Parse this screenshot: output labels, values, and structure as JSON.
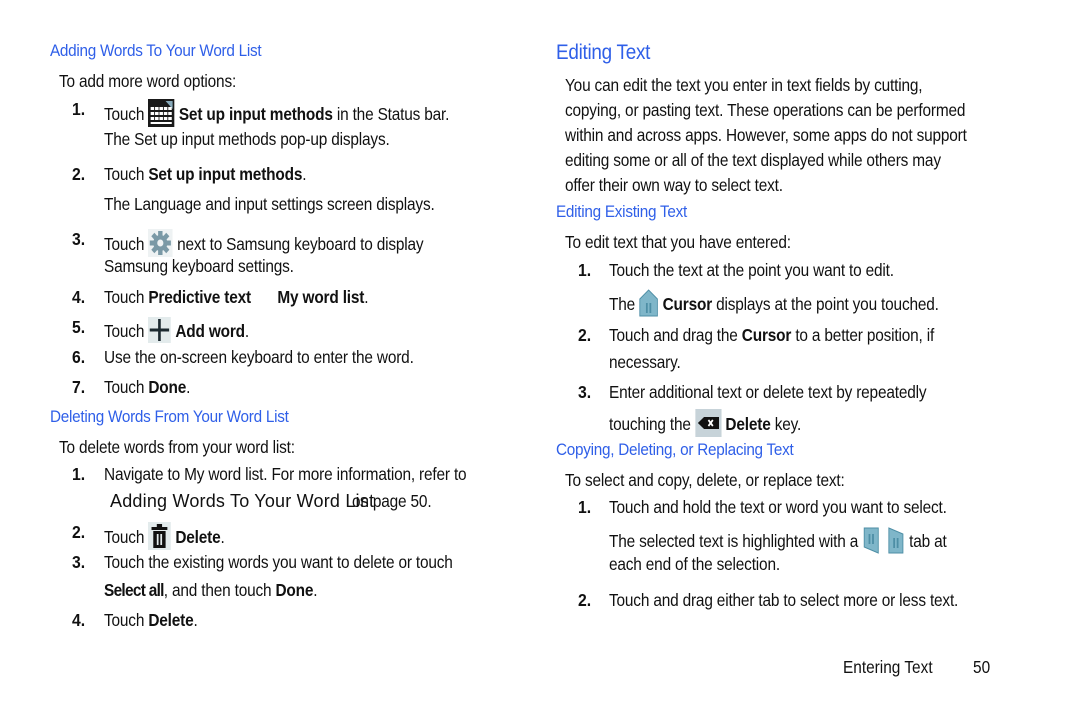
{
  "left": {
    "section1": {
      "heading": "Adding Words To Your Word List",
      "intro": "To add more word options:",
      "steps": [
        {
          "num": "1.",
          "pre": "Touch",
          "icon": "keyboard-icon",
          "bold": "Set up input methods",
          "post": " in the Status bar.",
          "sub": "The Set up input methods pop-up displays."
        },
        {
          "num": "2.",
          "pre": "Touch ",
          "bold": "Set up input methods",
          "post": ".",
          "sub": "The Language and input settings screen displays."
        },
        {
          "num": "3.",
          "pre": "Touch",
          "icon": "gear-icon",
          "post": " next to Samsung keyboard to display",
          "cont": "Samsung keyboard settings."
        },
        {
          "num": "4.",
          "pre": "Touch ",
          "bold": "Predictive text",
          "bold2": "My word list",
          "post": "."
        },
        {
          "num": "5.",
          "pre": "Touch",
          "icon": "plus-icon",
          "bold": "Add word",
          "post": "."
        },
        {
          "num": "6.",
          "pre": "Use the on-screen keyboard to enter the word."
        },
        {
          "num": "7.",
          "pre": "Touch ",
          "bold": "Done",
          "post": "."
        }
      ]
    },
    "section2": {
      "heading": "Deleting Words From Your Word List",
      "intro": "To delete words from your word list:",
      "steps": [
        {
          "num": "1.",
          "pre": "Navigate to My word list. For more information, refer to",
          "link": "Adding Words To Your Word List",
          "post": "on page 50."
        },
        {
          "num": "2.",
          "pre": "Touch",
          "icon": "trash-icon",
          "bold": "Delete",
          "post": "."
        },
        {
          "num": "3.",
          "pre": "Touch the existing words you want to delete or touch",
          "bold": "Select all",
          "mid": ", and then touch ",
          "bold2": "Done",
          "post": "."
        },
        {
          "num": "4.",
          "pre": "Touch ",
          "bold": "Delete",
          "post": "."
        }
      ]
    }
  },
  "right": {
    "title": "Editing Text",
    "paragraph": [
      "You can edit the text you enter in text fields by cutting,",
      "copying, or pasting text. These operations can be performed",
      "within and across apps. However, some apps do not support",
      "editing some or all of the text displayed while others may",
      "offer their own way to select text."
    ],
    "section1": {
      "heading": "Editing Existing Text",
      "intro": "To edit text that you have entered:",
      "steps": [
        {
          "num": "1.",
          "pre": "Touch the text at the point you want to edit.",
          "sub_pre": "The",
          "sub_icon": "cursor-icon",
          "sub_bold": "Cursor",
          "sub_post": " displays at the point you touched."
        },
        {
          "num": "2.",
          "pre": "Touch and drag the ",
          "bold": "Cursor",
          "post": " to a better position, if",
          "cont": "necessary."
        },
        {
          "num": "3.",
          "pre": "Enter additional text or delete text by repeatedly",
          "cont_pre": "touching the",
          "cont_icon": "backspace-icon",
          "cont_bold": "Delete",
          "cont_post": " key."
        }
      ]
    },
    "section2": {
      "heading": "Copying, Deleting, or Replacing Text",
      "intro": "To select and copy, delete, or replace text:",
      "steps": [
        {
          "num": "1.",
          "pre": "Touch and hold the text or word you want to select.",
          "sub_pre": "The selected text is highlighted with a",
          "sub_post": "tab at",
          "cont": "each end of the selection."
        },
        {
          "num": "2.",
          "pre": "Touch and drag either tab to select more or less text."
        }
      ]
    }
  },
  "footer": {
    "chapter": "Entering Text",
    "page": "50"
  },
  "colors": {
    "heading": "#2f5fe8",
    "text": "#111111",
    "icon_teal": "#7fb6c9",
    "icon_gray": "#7a99a6"
  }
}
